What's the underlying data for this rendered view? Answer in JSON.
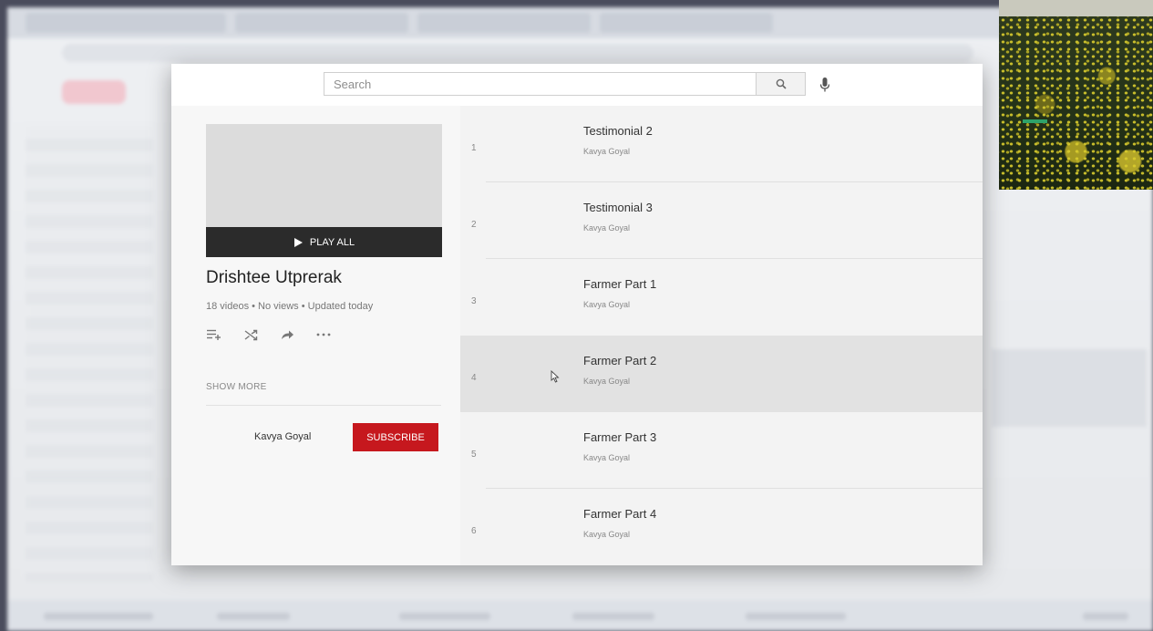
{
  "search": {
    "placeholder": "Search"
  },
  "playlist": {
    "play_all_label": "PLAY ALL",
    "title": "Drishtee Utprerak",
    "stats": "18 videos • No views • Updated today",
    "show_more_label": "SHOW MORE",
    "owner": "Kavya Goyal",
    "subscribe_label": "SUBSCRIBE"
  },
  "videos": [
    {
      "index": "1",
      "title": "Testimonial 2",
      "channel": "Kavya Goyal"
    },
    {
      "index": "2",
      "title": "Testimonial 3",
      "channel": "Kavya Goyal"
    },
    {
      "index": "3",
      "title": "Farmer Part 1",
      "channel": "Kavya Goyal"
    },
    {
      "index": "4",
      "title": "Farmer Part 2",
      "channel": "Kavya Goyal"
    },
    {
      "index": "5",
      "title": "Farmer Part 3",
      "channel": "Kavya Goyal"
    },
    {
      "index": "6",
      "title": "Farmer Part 4",
      "channel": "Kavya Goyal"
    }
  ],
  "icons": {
    "search": "search-icon",
    "mic": "mic-icon",
    "play": "play-icon",
    "add_to_queue": "add-to-queue-icon",
    "shuffle": "shuffle-icon",
    "share": "share-icon",
    "more": "more-icon"
  },
  "colors": {
    "subscribe": "#c6181e",
    "play_all_bar": "#2b2b2b",
    "hover_row": "#e2e2e2"
  }
}
